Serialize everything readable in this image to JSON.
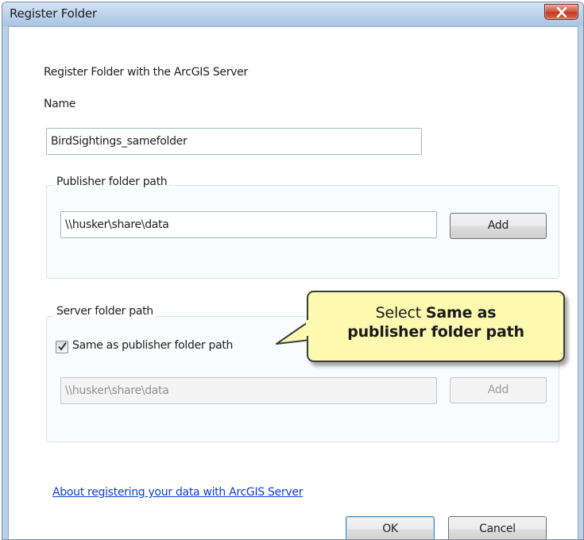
{
  "window": {
    "title": "Register Folder"
  },
  "dialog": {
    "heading": "Register Folder with the ArcGIS Server",
    "name_label": "Name",
    "name_value": "BirdSightings_samefolder",
    "publisher_group": {
      "caption": "Publisher folder path",
      "path_value": "\\\\husker\\share\\data",
      "add_label": "Add"
    },
    "server_group": {
      "caption": "Server folder path",
      "checkbox_label": "Same as publisher folder path",
      "checkbox_checked": true,
      "path_value": "\\\\husker\\share\\data",
      "add_label": "Add"
    },
    "help_link": "About registering your data with ArcGIS Server",
    "ok_label": "OK",
    "cancel_label": "Cancel"
  },
  "callout": {
    "prefix": "Select ",
    "bold_line1": "Same as",
    "bold_line2": "publisher folder path"
  },
  "icons": {
    "close": "close-icon",
    "check": "checkmark-icon"
  },
  "colors": {
    "titlebar": "#b9d1ea",
    "close_button": "#c23a23",
    "link": "#0f3fd1",
    "callout_fill": "#fdfab0"
  }
}
